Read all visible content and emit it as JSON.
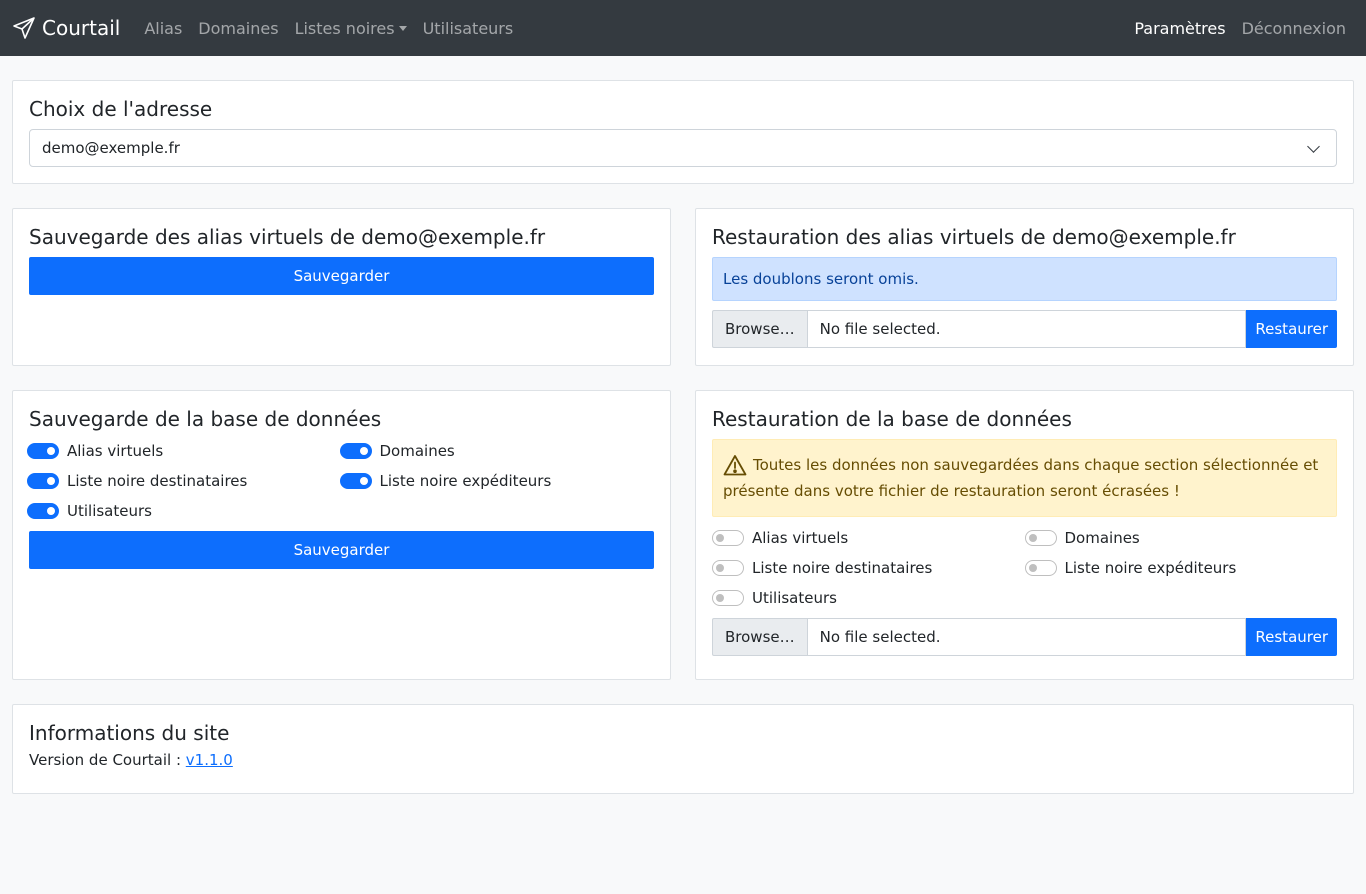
{
  "navbar": {
    "brand": "Courtail",
    "links": [
      {
        "label": "Alias"
      },
      {
        "label": "Domaines"
      },
      {
        "label": "Listes noires"
      },
      {
        "label": "Utilisateurs"
      }
    ],
    "right_links": [
      {
        "label": "Paramètres",
        "active": true
      },
      {
        "label": "Déconnexion",
        "active": false
      }
    ]
  },
  "address_choice": {
    "title": "Choix de l'adresse",
    "selected": "demo@exemple.fr"
  },
  "alias_backup": {
    "title": "Sauvegarde des alias virtuels de demo@exemple.fr",
    "button": "Sauvegarder"
  },
  "alias_restore": {
    "title": "Restauration des alias virtuels de demo@exemple.fr",
    "info": "Les doublons seront omis.",
    "browse": "Browse…",
    "file_placeholder": "No file selected.",
    "button": "Restaurer"
  },
  "db_backup": {
    "title": "Sauvegarde de la base de données",
    "switches": [
      {
        "label": "Alias virtuels",
        "checked": true
      },
      {
        "label": "Domaines",
        "checked": true
      },
      {
        "label": "Liste noire destinataires",
        "checked": true
      },
      {
        "label": "Liste noire expéditeurs",
        "checked": true
      },
      {
        "label": "Utilisateurs",
        "checked": true
      }
    ],
    "button": "Sauvegarder"
  },
  "db_restore": {
    "title": "Restauration de la base de données",
    "warning": "Toutes les données non sauvegardées dans chaque section sélectionnée et présente dans votre fichier de restauration seront écrasées !",
    "switches": [
      {
        "label": "Alias virtuels",
        "checked": false
      },
      {
        "label": "Domaines",
        "checked": false
      },
      {
        "label": "Liste noire destinataires",
        "checked": false
      },
      {
        "label": "Liste noire expéditeurs",
        "checked": false
      },
      {
        "label": "Utilisateurs",
        "checked": false
      }
    ],
    "browse": "Browse…",
    "file_placeholder": "No file selected.",
    "button": "Restaurer"
  },
  "site_info": {
    "title": "Informations du site",
    "version_label": "Version de Courtail :",
    "version": "v1.1.0"
  },
  "colors": {
    "primary": "#0d6efd",
    "navbar": "#343a40",
    "info_bg": "#cfe2ff",
    "warning_bg": "#fff3cd"
  }
}
